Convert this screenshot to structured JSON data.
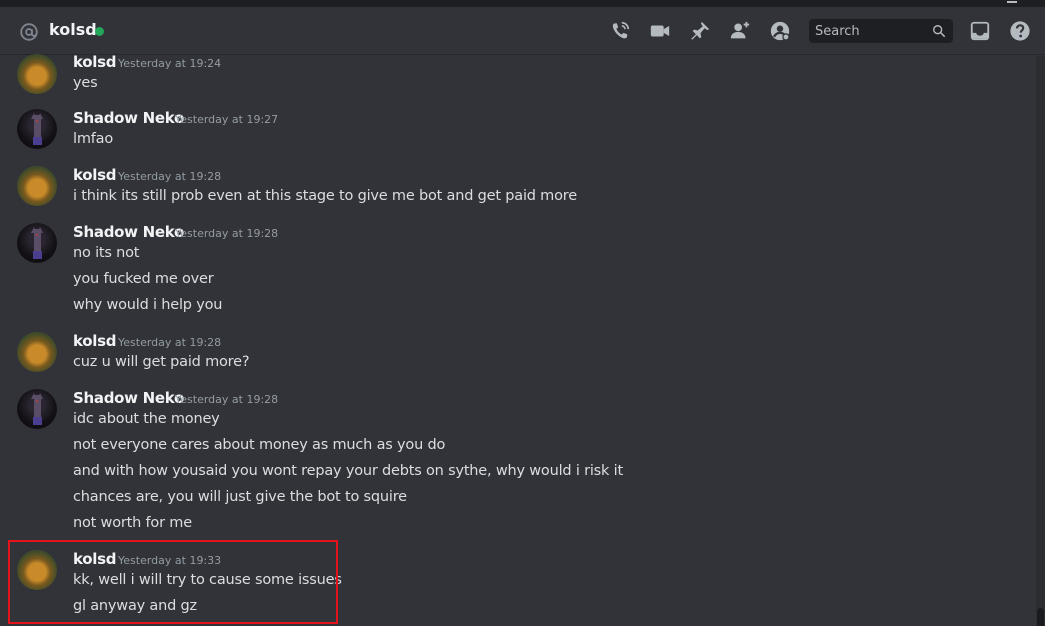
{
  "header": {
    "channel_name": "kolsd",
    "status_color": "#23a55a",
    "icons": [
      "at-icon",
      "voice-call-icon",
      "video-call-icon",
      "pin-icon",
      "add-friend-icon",
      "user-profile-icon",
      "search-icon",
      "inbox-icon",
      "help-icon"
    ],
    "search_placeholder": "Search"
  },
  "messages": [
    {
      "author": "kolsd",
      "timestamp": "Yesterday at 19:24",
      "lines": [
        "yes"
      ]
    },
    {
      "author": "Shadow Neko",
      "timestamp": "Yesterday at 19:27",
      "lines": [
        "lmfao"
      ]
    },
    {
      "author": "kolsd",
      "timestamp": "Yesterday at 19:28",
      "lines": [
        "i think its still prob even at this stage to give me bot and get paid more"
      ]
    },
    {
      "author": "Shadow Neko",
      "timestamp": "Yesterday at 19:28",
      "lines": [
        "no its not",
        "you fucked me over",
        "why would i help you"
      ]
    },
    {
      "author": "kolsd",
      "timestamp": "Yesterday at 19:28",
      "lines": [
        "cuz u will get paid more?"
      ]
    },
    {
      "author": "Shadow Neko",
      "timestamp": "Yesterday at 19:28",
      "lines": [
        "idc about the money",
        "not everyone cares about money as much as you do",
        "and with how yousaid you wont repay your debts on sythe, why would i risk it",
        "chances are, you will just give the bot to squire",
        "not worth for me"
      ]
    },
    {
      "author": "kolsd",
      "timestamp": "Yesterday at 19:33",
      "lines": [
        "kk, well i will try to cause some issues",
        "gl anyway and gz"
      ]
    }
  ],
  "colors": {
    "background": "#313338",
    "highlight_border": "#e3121b"
  }
}
